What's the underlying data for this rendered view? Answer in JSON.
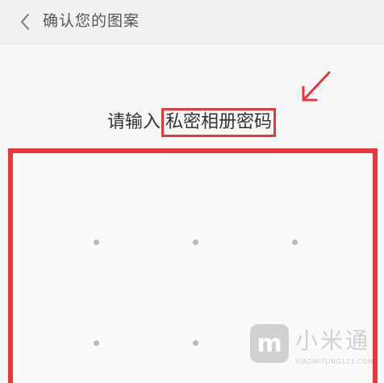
{
  "header": {
    "back_icon": "chevron-left-icon",
    "title": "确认您的图案"
  },
  "prompt": {
    "prefix": "请输入",
    "highlight": "私密相册密码"
  },
  "annotation": {
    "arrow_icon": "red-arrow-icon",
    "color": "#e4393c"
  },
  "pattern": {
    "visible_dots": 5,
    "dot_color": "#b8b8b8",
    "frame_color": "#e8383d"
  },
  "watermark": {
    "logo_text": "m",
    "name": "小米通",
    "url": "XIAOMITONG123.COM"
  }
}
